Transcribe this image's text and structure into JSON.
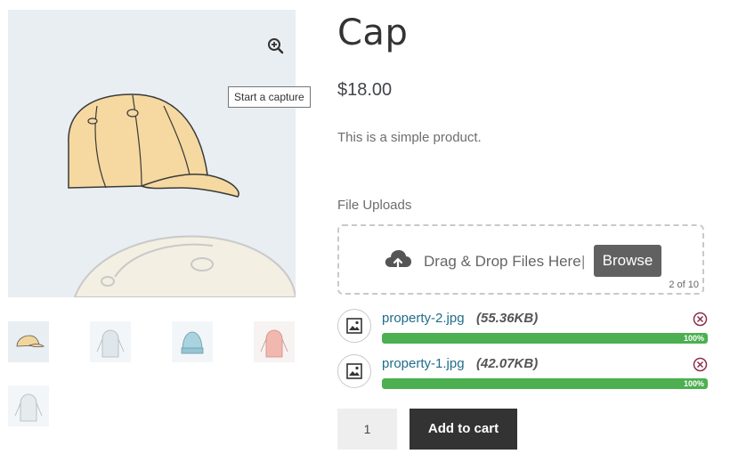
{
  "product": {
    "title": "Cap",
    "price": "$18.00",
    "description": "This is a simple product."
  },
  "gallery": {
    "tooltip": "Start a capture",
    "zoom_icon": "zoom-in-icon",
    "thumbnails": [
      {
        "name": "cap",
        "colors": [
          "#f2d59a"
        ]
      },
      {
        "name": "hoodie-light",
        "colors": [
          "#dfe7ec"
        ]
      },
      {
        "name": "beanie-blue",
        "colors": [
          "#a9d3de"
        ]
      },
      {
        "name": "hoodie-pink",
        "colors": [
          "#f2b8b0"
        ]
      },
      {
        "name": "hoodie-gray",
        "colors": [
          "#e6ebee"
        ]
      }
    ]
  },
  "uploads": {
    "label": "File Uploads",
    "drop_text": "Drag & Drop Files Here",
    "separator": "|",
    "browse_label": "Browse",
    "count": "2 of 10",
    "files": [
      {
        "name": "property-2.jpg",
        "size": "(55.36KB)",
        "progress": 1.0,
        "progress_text": "100%"
      },
      {
        "name": "property-1.jpg",
        "size": "(42.07KB)",
        "progress": 1.0,
        "progress_text": "100%"
      }
    ]
  },
  "cart": {
    "quantity": "1",
    "add_label": "Add to cart"
  },
  "colors": {
    "progress": "#4caf50",
    "button_dark": "#333333",
    "browse": "#616161",
    "link": "#1f6e8a"
  }
}
